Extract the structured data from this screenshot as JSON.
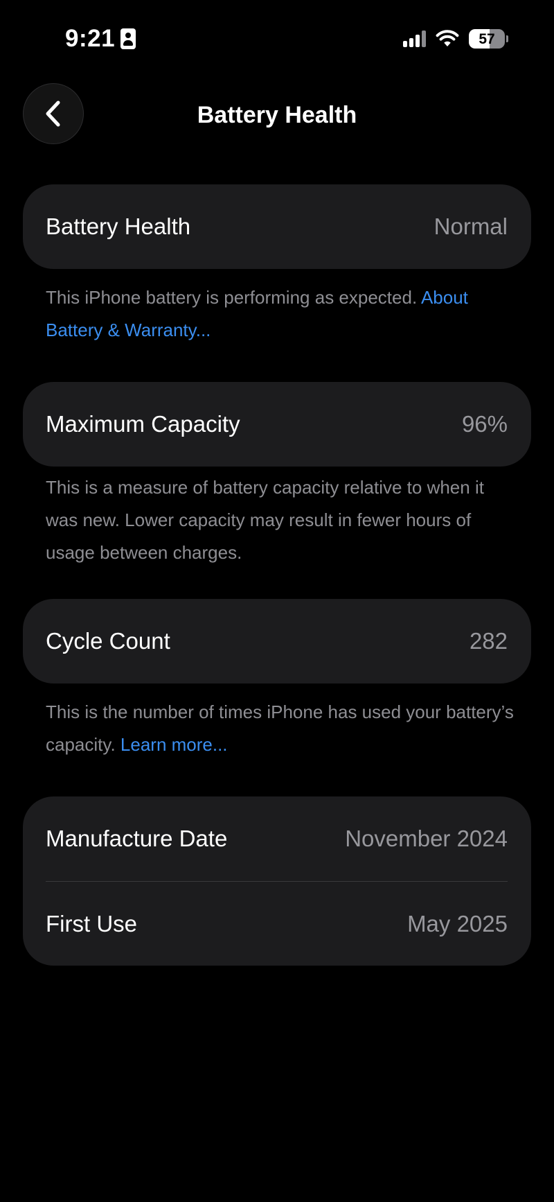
{
  "status_bar": {
    "time": "9:21",
    "battery_level": "57",
    "battery_fraction": 0.57,
    "icons": [
      "id-card-icon",
      "cellular-signal-icon",
      "wifi-icon",
      "battery-icon"
    ]
  },
  "nav": {
    "back_icon": "chevron-left-icon",
    "title": "Battery Health"
  },
  "sections": {
    "battery_health": {
      "label": "Battery Health",
      "value": "Normal",
      "footnote": "This iPhone battery is performing as expected. ",
      "link": "About Battery & Warranty..."
    },
    "maximum_capacity": {
      "label": "Maximum Capacity",
      "value": "96%",
      "footnote": "This is a measure of battery capacity relative to when it was new. Lower capacity may result in fewer hours of usage between charges."
    },
    "cycle_count": {
      "label": "Cycle Count",
      "value": "282",
      "footnote": "This is the number of times iPhone has used your battery’s capacity. ",
      "link": "Learn more..."
    },
    "dates": {
      "manufacture_label": "Manufacture Date",
      "manufacture_value": "November 2024",
      "first_use_label": "First Use",
      "first_use_value": "May 2025"
    }
  },
  "colors": {
    "background": "#000000",
    "card": "#1c1c1e",
    "secondary_text": "#98989d",
    "footnote_text": "#8e8e93",
    "link": "#3b8ef0"
  }
}
